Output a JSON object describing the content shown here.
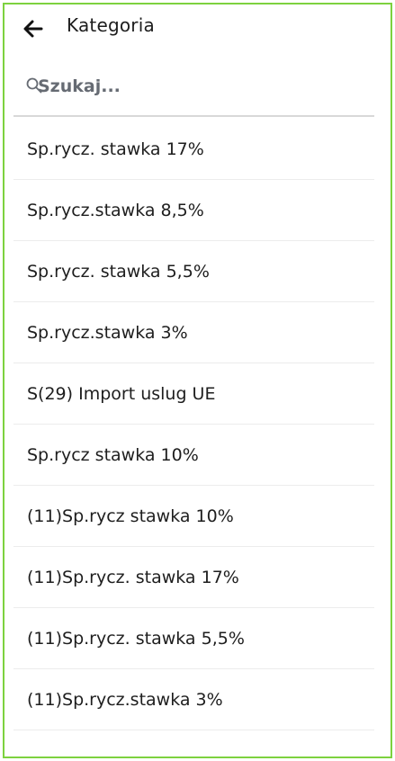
{
  "header": {
    "title": "Kategoria"
  },
  "icons": {
    "back": "arrow-left-icon",
    "search": "search-icon"
  },
  "search": {
    "placeholder": "Szukaj...",
    "value": ""
  },
  "categories": [
    "Sp.rycz. stawka 17%",
    "Sp.rycz.stawka 8,5%",
    "Sp.rycz. stawka 5,5%",
    "Sp.rycz.stawka 3%",
    "S(29) Import uslug UE",
    "Sp.rycz stawka 10%",
    "(11)Sp.rycz stawka 10%",
    "(11)Sp.rycz. stawka 17%",
    "(11)Sp.rycz. stawka 5,5%",
    "(11)Sp.rycz.stawka 3%"
  ],
  "colors": {
    "frame_border": "#7dd23f",
    "divider": "#ececec",
    "search_underline": "#d8d8d8",
    "text": "#1e1e1e"
  }
}
